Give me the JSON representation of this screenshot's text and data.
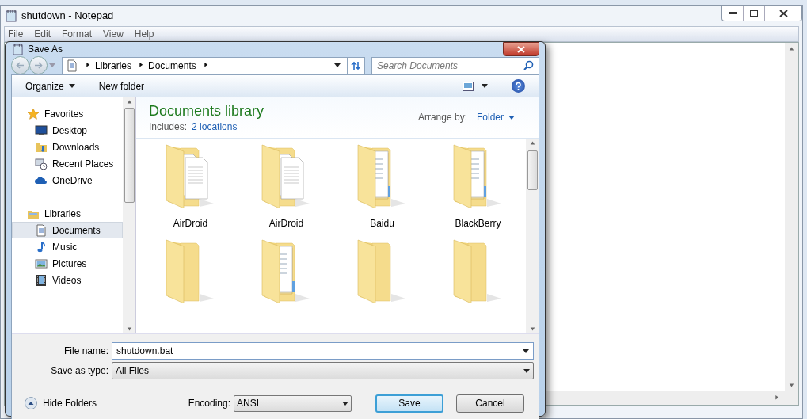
{
  "notepad": {
    "title": "shutdown - Notepad",
    "menu": [
      "File",
      "Edit",
      "Format",
      "View",
      "Help"
    ]
  },
  "dialog": {
    "title": "Save As",
    "breadcrumb": [
      "Libraries",
      "Documents"
    ],
    "search": {
      "placeholder": "Search Documents"
    },
    "toolbar": {
      "organize": "Organize",
      "new_folder": "New folder"
    },
    "nav": [
      {
        "label": "Favorites",
        "kind": "header",
        "selected": false
      },
      {
        "label": "Desktop",
        "kind": "item",
        "selected": false
      },
      {
        "label": "Downloads",
        "kind": "item",
        "selected": false
      },
      {
        "label": "Recent Places",
        "kind": "item",
        "selected": false
      },
      {
        "label": "OneDrive",
        "kind": "item",
        "selected": false
      },
      {
        "label": "Libraries",
        "kind": "header",
        "selected": false
      },
      {
        "label": "Documents",
        "kind": "item",
        "selected": true
      },
      {
        "label": "Music",
        "kind": "item",
        "selected": false
      },
      {
        "label": "Pictures",
        "kind": "item",
        "selected": false
      },
      {
        "label": "Videos",
        "kind": "item",
        "selected": false
      }
    ],
    "library": {
      "title": "Documents library",
      "includes_label": "Includes:",
      "includes_link": "2 locations",
      "arrange_label": "Arrange by:",
      "arrange_value": "Folder"
    }
  },
  "folders": [
    {
      "name": "AirDroid",
      "kind": "documents"
    },
    {
      "name": "AirDroid",
      "kind": "documents"
    },
    {
      "name": "Baidu",
      "kind": "files"
    },
    {
      "name": "BlackBerry",
      "kind": "files"
    },
    {
      "kind": "plain"
    },
    {
      "kind": "files"
    },
    {
      "kind": "plain"
    },
    {
      "kind": "plain"
    }
  ],
  "file_name": {
    "label": "File name:",
    "value": "shutdown.bat"
  },
  "save_type": {
    "label": "Save as type:",
    "value": "All Files"
  },
  "hide_folders": "Hide Folders",
  "encoding": {
    "label": "Encoding:",
    "value": "ANSI"
  },
  "buttons": [
    {
      "label": "Save",
      "default": true
    },
    {
      "label": "Cancel",
      "default": false
    }
  ]
}
